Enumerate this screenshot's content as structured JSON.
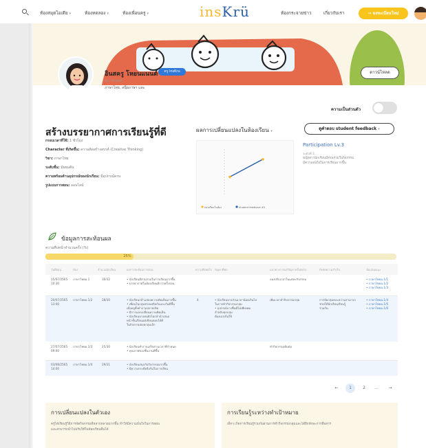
{
  "nav": {
    "items": [
      {
        "label": "ห้องสมุดไอเดีย",
        "chevron": true
      },
      {
        "label": "ห้องทดลอง",
        "chevron": true
      },
      {
        "label": "ห้องเพื่อนครู",
        "chevron": true
      }
    ],
    "logo_ins": "ins",
    "logo_kru": "Krü",
    "right_links": [
      "ห้องกระจายข่าว",
      "เกี่ยวกับเรา"
    ],
    "register_label": "→ ลงทะเบียนใหม่",
    "icons": {
      "search": "search-icon",
      "user": "user-avatar-icon"
    }
  },
  "profile": {
    "name": "อินสครู โหยนแนนต์",
    "badge": "ครู insKru",
    "role": "ครู / ติวเตอร์",
    "school": "ภาษาไทย, สนุ๊ยภาษา และ",
    "download_label": "ดาวน์โหลด"
  },
  "privacy": {
    "label": "ความเป็นส่วนตัว",
    "enabled": false
  },
  "activity": {
    "title": "สร้างบรรยากาศการเรียนรู้ที่ดี",
    "rows": [
      {
        "key": "กรอบเวลาที่ใช้:",
        "value": "1 ชั่วโมง"
      },
      {
        "key": "Character ที่เกิดขึ้น:",
        "value": "ความคิดสร้างสรรค์ (Creative Thinking)"
      },
      {
        "key": "วิชา:",
        "value": "ภาษาไทย"
      },
      {
        "key": "ระดับชั้น:",
        "value": "มัธยมต้น"
      },
      {
        "key": "ความพร้อมด้านอุปกรณ์ของนักเรียน:",
        "value": "มีอุปกรณ์ครบ"
      },
      {
        "key": "รูปแบบการสอน:",
        "value": "ออนไลน์"
      }
    ]
  },
  "change": {
    "title": "ผลการเปลี่ยนแปลงในห้องเรียน",
    "feedback_label": "ดูคำตอบ student feedback",
    "participation_title": "Participation Lv.3",
    "participation_sub": "ระดับที่ 3",
    "desc_line1": "หญิงสาวนักเรียนมีส่วนร่วมในกิจกรรม",
    "desc_line2": "มีความสนใจในการเรียนมากขึ้น"
  },
  "chart_data": {
    "type": "line",
    "title": "",
    "xlabel": "",
    "ylabel": "",
    "legend": [
      "ก่อนเรียนในห้อง",
      "Student feedback #2"
    ],
    "series": [
      {
        "name": "ก่อนเรียนในห้อง",
        "values": [
          1,
          2
        ]
      },
      {
        "name": "Student feedback #2",
        "values": [
          2,
          4
        ]
      }
    ],
    "x": [
      1,
      2
    ],
    "ylim": [
      0,
      5
    ],
    "colors": {
      "line": "#2d5fa8",
      "point": "#f7b731"
    }
  },
  "eval": {
    "title": "ข้อมูลการสะท้อนผล",
    "progress_label": "ความคืบหน้าจำนวนครั้ง (%)",
    "progress_percent": 25,
    "progress_text": "25%"
  },
  "table": {
    "headers": [
      "วันที่สอน",
      "ห้อง",
      "จำนวนนักเรียน",
      "ผลการสะท้อนการสอน",
      "ความพึงพอใจ",
      "ปัญหาที่พบ",
      "แนวทางการแก้ปัญหาครั้งต่อไป",
      "ปัจจัยความสำเร็จ",
      "ข้อเสนอแนะ"
    ],
    "rows": [
      {
        "date": [
          "15/07/2565",
          "10:30"
        ],
        "room": "ภาษาไทยม.1",
        "students": "30/32",
        "reflect": [
          "• นักเรียนมีส่วนร่วมในการเรียนมากขึ้น",
          "• บรรยากาศในห้องเรียนดีกว่าครั้งก่อน"
        ],
        "score": "",
        "problem": [],
        "solution": [
          "ลองปรับเวลาในแต่ละกิจกรรม"
        ],
        "factor": [],
        "suggest": [
          "• ภาษาไทยม.1/1",
          "• ภาษาไทยม.1/2",
          "• ภาษาไทยม.1/3"
        ]
      },
      {
        "date": [
          "20/07/2565",
          "13:00"
        ],
        "room": "ภาษาไทยม.1/2",
        "students": "28/30",
        "reflect": [
          "• นักเรียนกล้าแสดงความคิดเห็นมากขึ้น",
          "• เพื่อนในกลุ่มช่วยเหลือกันและกันดีขึ้น",
          "  เมื่อครูตั้งคำถามปลายเปิด",
          "• มีการแลกเปลี่ยนความคิดเห็น",
          "• นักเรียนบางคนยังไม่กล้านำเสนอ",
          "  หน้าชั้นเรียนแต่เขียนตอบได้ดี",
          "  ในกิจกรรมย่อยกลุ่มเล็ก"
        ],
        "score": "4",
        "problem": [
          "• นักเรียนบางส่วนเวลาน้อยเกินไป",
          "  ในการทำกิจกรรมกลุ่ม",
          "• อุปกรณ์บางชิ้นมีไม่เพียงพอ",
          "  สำหรับทุกกลุ่ม",
          "  ต้องแบ่งกันใช้"
        ],
        "solution": [
          "เพิ่มเวลาทำกิจกรรมกลุ่ม"
        ],
        "factor": [
          "การจัดกลุ่มคละความสามารถ",
          "ช่วยให้นักเรียนเรียนรู้",
          "ร่วมกัน"
        ],
        "suggest": [
          "• ภาษาไทยม.1/4",
          "• ภาษาไทยม.1/5",
          "• ภาษาไทยม.1/6"
        ]
      },
      {
        "date": [
          "27/07/2565",
          "09:00"
        ],
        "room": "ภาษาไทยม.1/3",
        "students": "25/30",
        "reflect": [
          "• นักเรียนทำงานเสร็จตามเวลาที่กำหนด",
          "• คุณภาพของชิ้นงานดีขึ้น"
        ],
        "score": "",
        "problem": [],
        "solution": [
          "ทำกิจกรรมเดิมต่อ"
        ],
        "factor": [],
        "suggest": []
      },
      {
        "date": [
          "03/08/2565",
          "14:00"
        ],
        "room": "ภาษาไทยม.1/4",
        "students": "29/31",
        "reflect": [
          "• นักเรียนสนุกกับกิจกรรมมากขึ้น",
          "• มีความกระตือรือร้นในการเรียน"
        ],
        "score": "",
        "problem": [],
        "solution": [],
        "factor": [],
        "suggest": []
      }
    ]
  },
  "pagination": {
    "prev": "←",
    "pages": [
      "1",
      "2"
    ],
    "more": "...",
    "next": "→"
  },
  "bottom": {
    "left_title": "การเปลี่ยนแปลงในตัวเอง",
    "left_text1": "ครูได้เรียนรู้วิธีการจัดกิจกรรมที่หลากหลายมากขึ้น ทำให้มีความมั่นใจในการสอน",
    "left_text2": "และสามารถนำไปปรับใช้ในห้องเรียนอื่นได้",
    "right_title": "การเรียนรู้ระหว่างทำเป้าหมาย",
    "right_text1": "เด็กๆ เกิดการเรียนรู้ร่วมกันผ่านการทำกิจกรรมกลุ่มและได้ฝึกทักษะการสื่อสาร"
  }
}
